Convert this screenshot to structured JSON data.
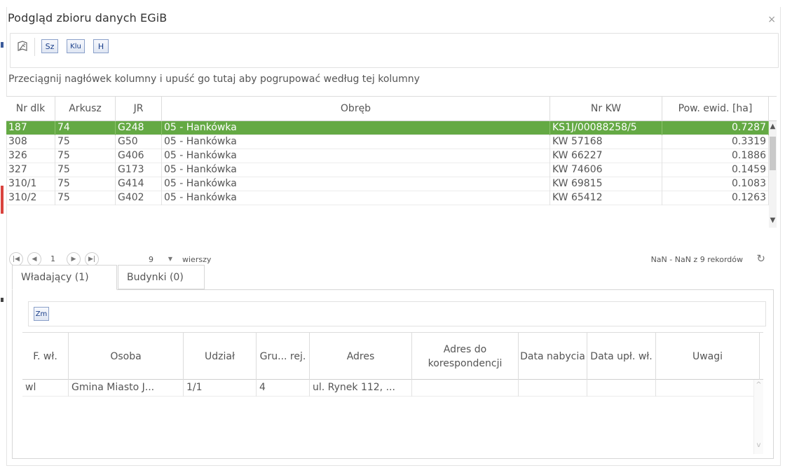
{
  "window": {
    "title": "Podgląd zbioru danych EGiB",
    "close_glyph": "×"
  },
  "toolbar": {
    "buttons": [
      {
        "icon": "map-locate-icon",
        "label": ""
      },
      {
        "icon": "sz-icon",
        "label": "Sz"
      },
      {
        "icon": "klu-icon",
        "label": "Klu"
      },
      {
        "icon": "h-icon",
        "label": "H"
      }
    ]
  },
  "group_hint": "Przeciągnij nagłówek kolumny i upuść go tutaj aby pogrupować według tej kolumny",
  "parcels": {
    "columns": [
      "Nr dlk",
      "Arkusz",
      "JR",
      "Obręb",
      "Nr KW",
      "Pow. ewid. [ha]"
    ],
    "rows": [
      [
        "187",
        "74",
        "G248",
        "05 - Hankówka",
        "KS1J/00088258/5",
        "0.7287"
      ],
      [
        "308",
        "75",
        "G50",
        "05 - Hankówka",
        "KW 57168",
        "0.3319"
      ],
      [
        "326",
        "75",
        "G406",
        "05 - Hankówka",
        "KW 66227",
        "0.1886"
      ],
      [
        "327",
        "75",
        "G173",
        "05 - Hankówka",
        "KW 74606",
        "0.1459"
      ],
      [
        "310/1",
        "75",
        "G414",
        "05 - Hankówka",
        "KW 69815",
        "0.1083"
      ],
      [
        "310/2",
        "75",
        "G402",
        "05 - Hankówka",
        "KW 65412",
        "0.1263"
      ]
    ],
    "selected_row": 0,
    "selection_color": "#64a944"
  },
  "pager": {
    "page": "1",
    "page_size": "9",
    "rows_label": "wierszy",
    "info": "NaN - NaN z 9 rekordów"
  },
  "tabs": [
    {
      "label": "Władający (1)",
      "active": true
    },
    {
      "label": "Budynki (0)",
      "active": false
    }
  ],
  "owners": {
    "toolbar_button": "Zm",
    "columns": [
      "F. wł.",
      "Osoba",
      "Udział",
      "Gru... rej.",
      "Adres",
      "Adres do korespondencji",
      "Data nabycia",
      "Data upł. wł.",
      "Uwagi"
    ],
    "rows": [
      [
        "wl",
        "Gmina Miasto J...",
        "1/1",
        "4",
        "ul. Rynek 112, ...",
        "",
        "",
        "",
        ""
      ]
    ]
  }
}
